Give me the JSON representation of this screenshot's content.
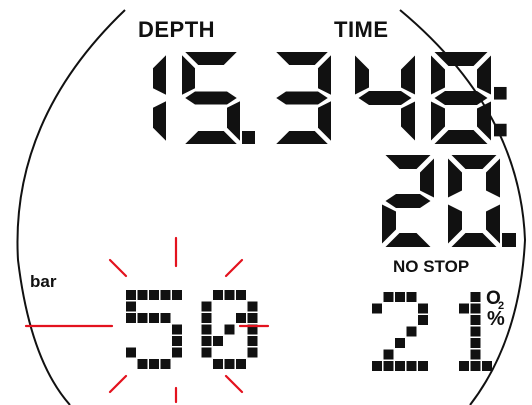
{
  "labels": {
    "depth": "DEPTH",
    "time": "TIME",
    "no_stop": "NO STOP",
    "bar": "bar",
    "o2": "O",
    "o2_subscript": "2",
    "percent": "%"
  },
  "readings": {
    "depth": "15.3",
    "dive_time_minutes": "48:",
    "dive_time_seconds": "20.",
    "tank_pressure": "50",
    "oxygen_percent": "21"
  },
  "status": {
    "tank_pressure_warning_flashing": true
  },
  "colors": {
    "segments": "#111111",
    "warning_rays": "#e3121e",
    "bezel": "#111111"
  }
}
